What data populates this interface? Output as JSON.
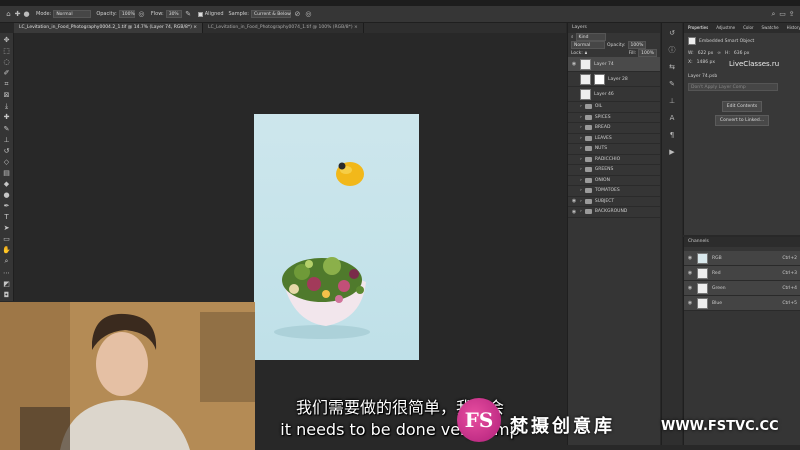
{
  "options_bar": {
    "mode_label": "Mode:",
    "mode_value": "Normal",
    "opacity_label": "Opacity:",
    "opacity_value": "100%",
    "flow_label": "Flow:",
    "flow_value": "30%",
    "aligned_label": "Aligned",
    "sample_label": "Sample:",
    "sample_value": "Current & Below"
  },
  "document_tabs": [
    {
      "label": "LC_Levitation_in_Food_Photography0004.2_1.tif @ 14.7% (Layer 74, RGB/8*)"
    },
    {
      "label": "LC_Levitation_in_Food_Photography0074_1.tif @ 100% (RGB/8*)"
    }
  ],
  "layers_panel": {
    "tab": "Layers",
    "kind_label": "Kind",
    "blend_mode": "Normal",
    "opacity_label": "Opacity:",
    "opacity_value": "100%",
    "lock_label": "Lock:",
    "fill_label": "Fill:",
    "fill_value": "100%",
    "layers": [
      {
        "name": "Layer 74",
        "selected": true,
        "thumb": true
      },
      {
        "name": "Layer 28",
        "selected": false,
        "thumb": true
      },
      {
        "name": "Layer 46",
        "selected": false,
        "thumb": true
      },
      {
        "name": "OIL",
        "folder": true
      },
      {
        "name": "SPICES",
        "folder": true
      },
      {
        "name": "BREAD",
        "folder": true
      },
      {
        "name": "LEAVES",
        "folder": true
      },
      {
        "name": "NUTS",
        "folder": true
      },
      {
        "name": "RADICCHIO",
        "folder": true
      },
      {
        "name": "GREENS",
        "folder": true
      },
      {
        "name": "ONION",
        "folder": true
      },
      {
        "name": "TOMATOES",
        "folder": true
      },
      {
        "name": "SUBJECT",
        "folder": true
      },
      {
        "name": "BACKGROUND",
        "folder": true
      }
    ]
  },
  "properties_panel": {
    "tabs": [
      "Properties",
      "Adjustme",
      "Color",
      "Swatche",
      "History"
    ],
    "object_type": "Embedded Smart Object",
    "w_label": "W:",
    "w_value": "622 px",
    "h_label": "H:",
    "h_value": "636 px",
    "x_label": "X:",
    "x_value": "1486 px",
    "layer_name": "Layer 74.psb",
    "layer_comp": "Don't Apply Layer Comp",
    "edit_contents": "Edit Contents",
    "convert_linked": "Convert to Linked...",
    "watermark": "LiveClasses.ru"
  },
  "channels_panel": {
    "tab": "Channels",
    "channels": [
      {
        "name": "RGB",
        "shortcut": "Ctrl+2"
      },
      {
        "name": "Red",
        "shortcut": "Ctrl+3"
      },
      {
        "name": "Green",
        "shortcut": "Ctrl+4"
      },
      {
        "name": "Blue",
        "shortcut": "Ctrl+5"
      }
    ]
  },
  "subtitles": {
    "chinese": "我们需要做的很简单，我将会",
    "english": "it needs to be done very simp"
  },
  "watermark": {
    "logo": "FS",
    "name": "梵摄创意库",
    "url": "WWW.FSTVC.CC"
  },
  "colors": {
    "accent": "#e84ea0",
    "canvas_bg": "#c5e3ea",
    "panel_bg": "#353535"
  }
}
